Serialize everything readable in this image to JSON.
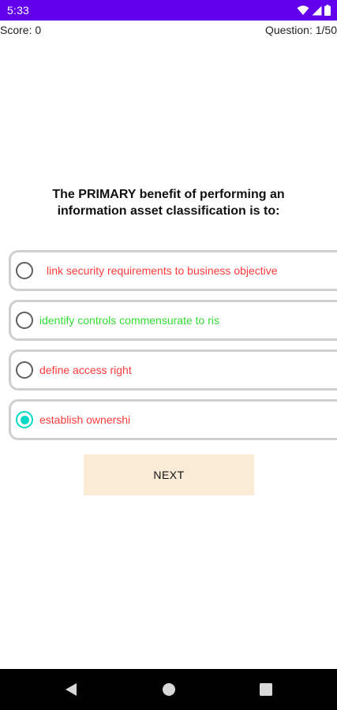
{
  "status_bar": {
    "time": "5:33",
    "icons": [
      "wifi-icon",
      "signal-icon",
      "battery-icon"
    ],
    "background": "#6200ee"
  },
  "header": {
    "score": "Score: 0",
    "question_counter": "Question: 1/50"
  },
  "question": {
    "text": "The PRIMARY benefit of performing an information asset classification is to:"
  },
  "options": [
    {
      "text": "link security requirements to business objective",
      "color": "#ff3b3b",
      "selected": false
    },
    {
      "text": "identify controls commensurate to ris",
      "color": "#33dd33",
      "selected": false
    },
    {
      "text": "define access right",
      "color": "#ff3b3b",
      "selected": false
    },
    {
      "text": "establish ownershi",
      "color": "#ff3b3b",
      "selected": true
    }
  ],
  "next_button": {
    "label": "NEXT",
    "background": "#faebd7"
  },
  "nav_bar": {
    "buttons": [
      "back-icon",
      "home-icon",
      "recents-icon"
    ]
  },
  "colors": {
    "accent": "#03dac5",
    "correct": "#33dd33",
    "incorrect": "#ff3b3b"
  }
}
